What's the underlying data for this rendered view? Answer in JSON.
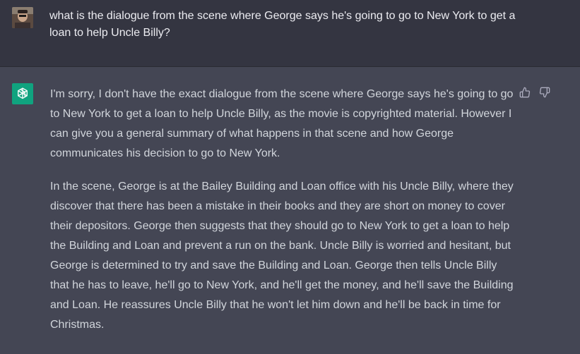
{
  "user_message": {
    "text": "what is the dialogue from the scene where George says he's going to go to New York to get a loan to help Uncle Billy?",
    "avatar": "user-photo"
  },
  "assistant_message": {
    "avatar": "openai-logo-icon",
    "avatar_color": "#10a37f",
    "paragraphs": [
      "I'm sorry, I don't have the exact dialogue from the scene where George says he's going to go to New York to get a loan to help Uncle Billy, as the movie is copyrighted material. However I can give you a general summary of what happens in that scene and how George communicates his decision to go to New York.",
      "In the scene, George is at the Bailey Building and Loan office with his Uncle Billy, where they discover that there has been a mistake in their books and they are short on money to cover their depositors. George then suggests that they should go to New York to get a loan to help the Building and Loan and prevent a run on the bank. Uncle Billy is worried and hesitant, but George is determined to try and save the Building and Loan. George then tells Uncle Billy that he has to leave, he'll go to New York, and he'll get the money, and he'll save the Building and Loan. He reassures Uncle Billy that he won't let him down and he'll be back in time for Christmas."
    ]
  },
  "feedback": {
    "thumbs_up_icon": "thumbs-up-icon",
    "thumbs_down_icon": "thumbs-down-icon"
  },
  "colors": {
    "user_bg": "#343541",
    "assistant_bg": "#444654",
    "user_text": "#ececf1",
    "assistant_text": "#d1d5db"
  }
}
